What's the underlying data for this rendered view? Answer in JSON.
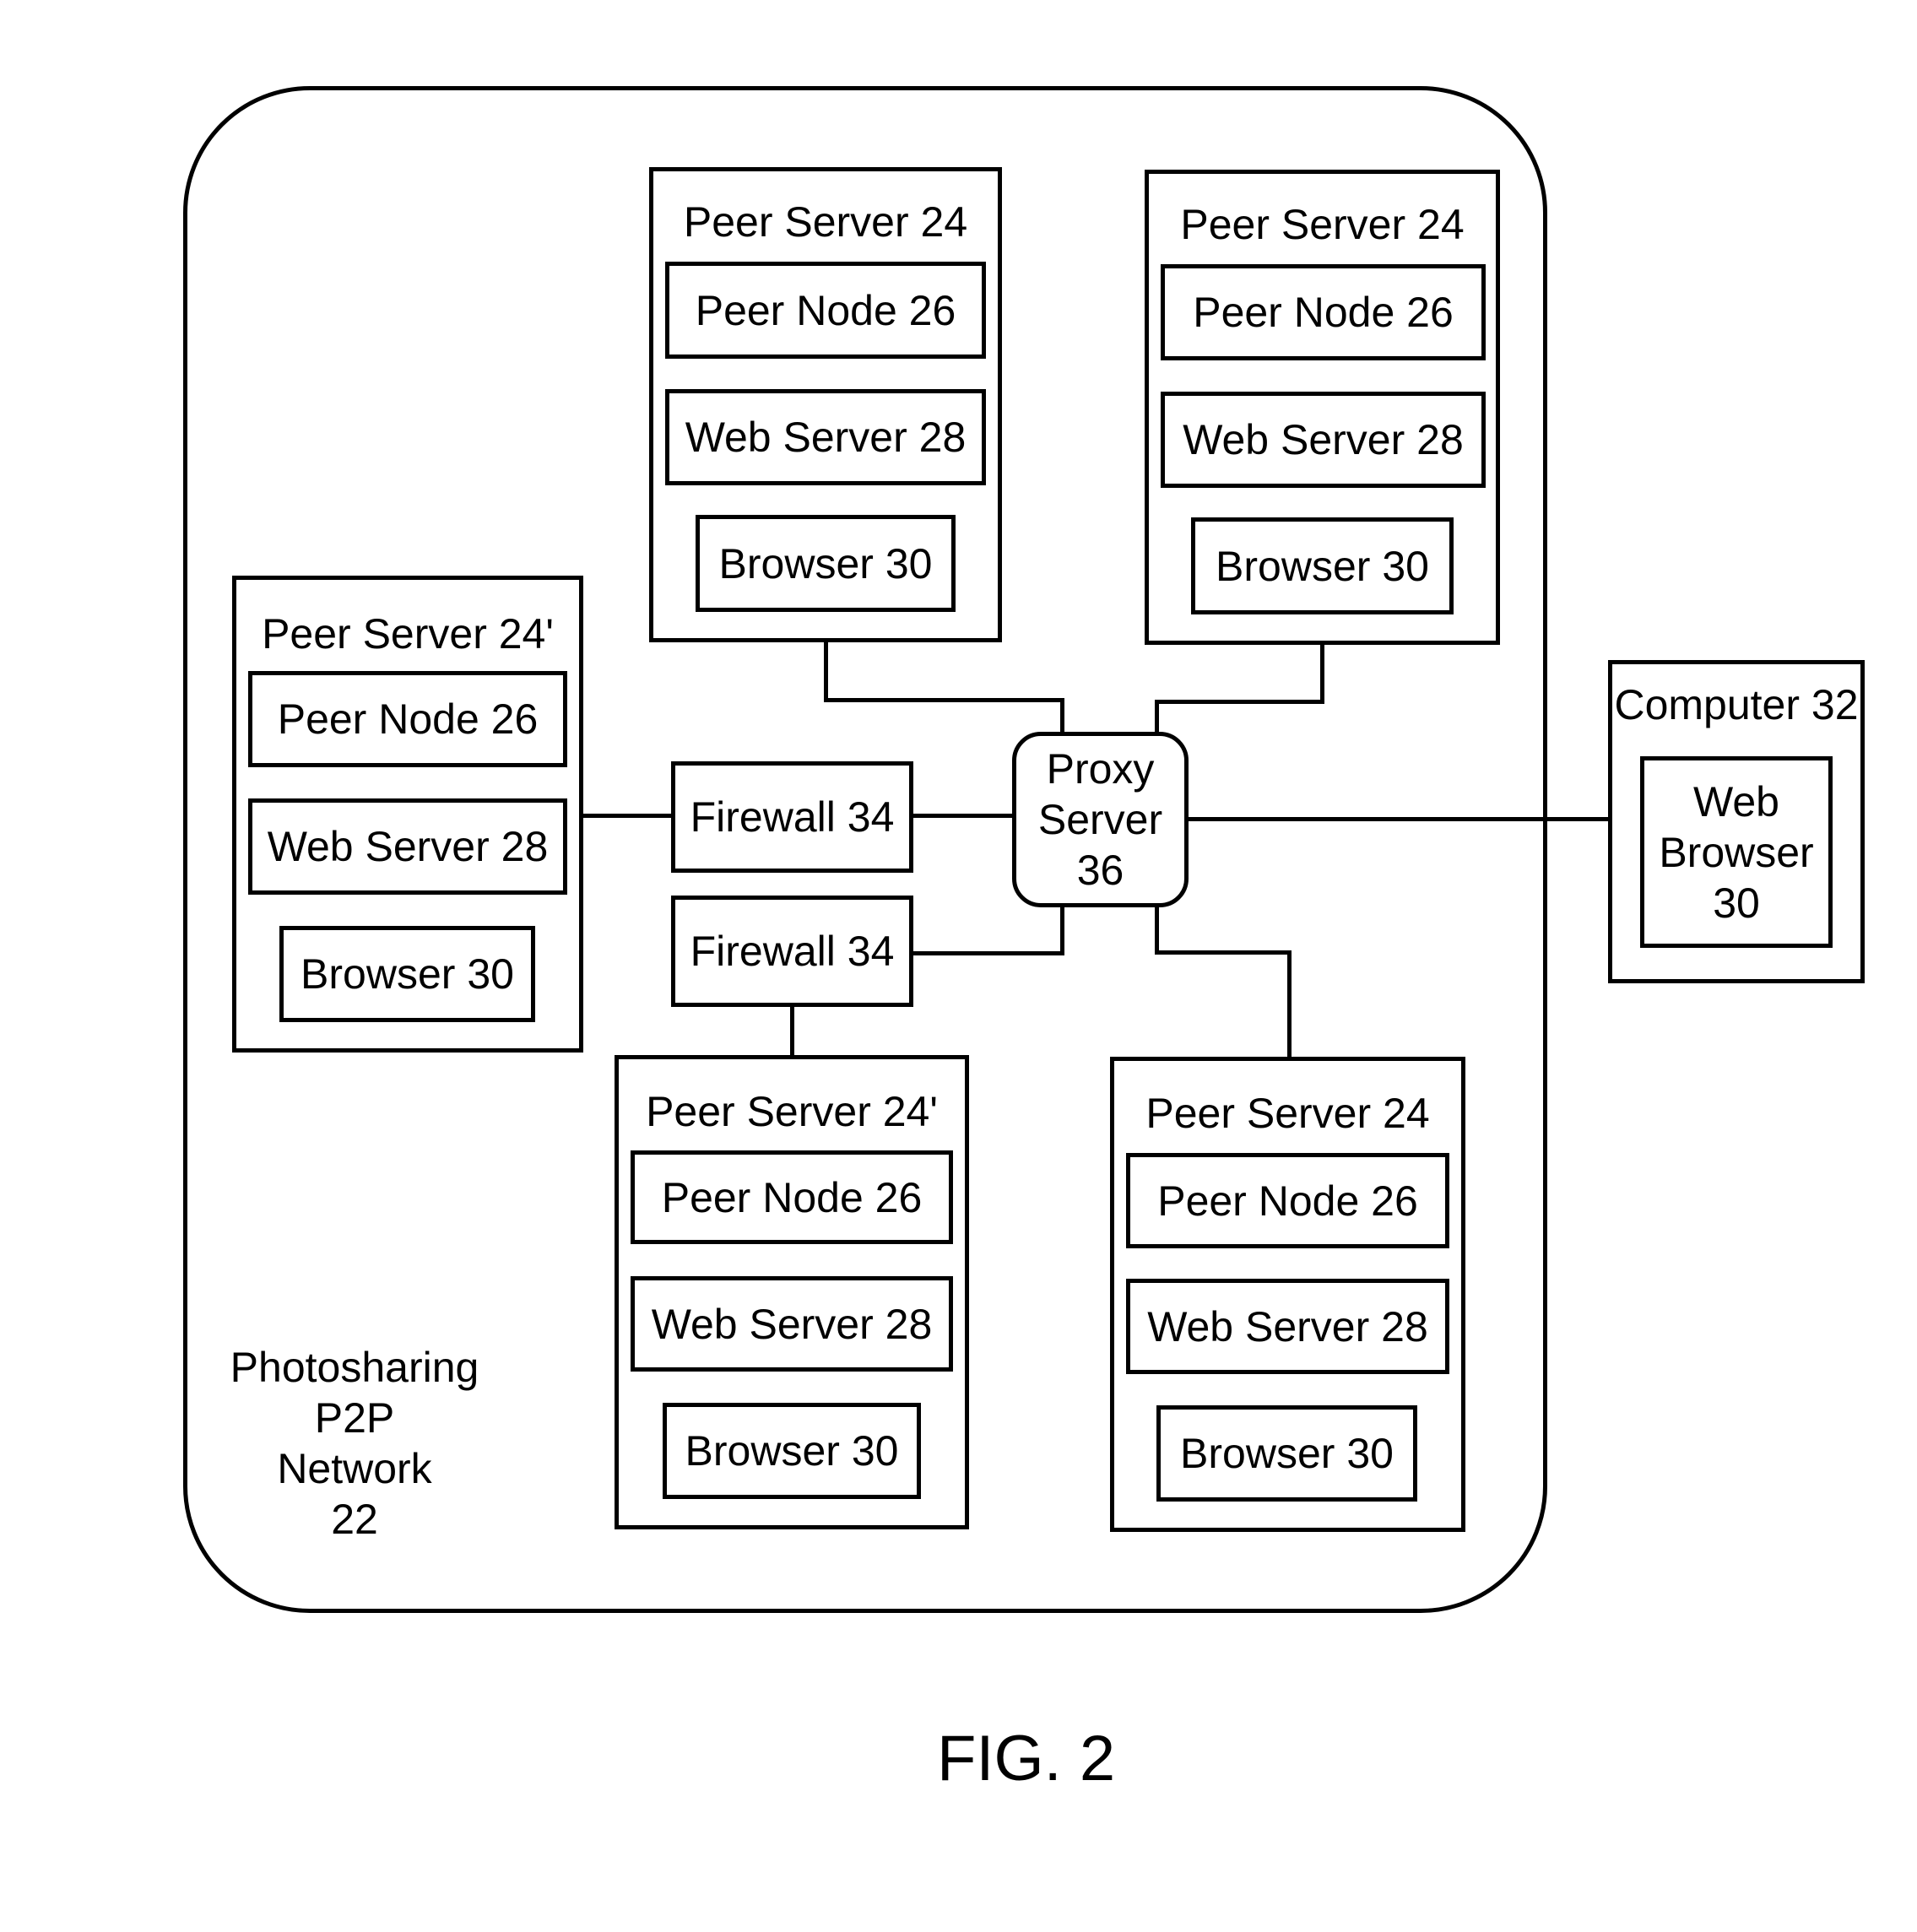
{
  "figure_label": "FIG. 2",
  "network": {
    "line1": "Photosharing",
    "line2": "P2P",
    "line3": "Network",
    "line4": "22"
  },
  "peer_servers": [
    {
      "title": "Peer Server 24",
      "peer_node": "Peer Node 26",
      "web_server": "Web Server 28",
      "browser": "Browser 30"
    },
    {
      "title": "Peer Server 24",
      "peer_node": "Peer Node 26",
      "web_server": "Web Server 28",
      "browser": "Browser 30"
    },
    {
      "title": "Peer Server 24'",
      "peer_node": "Peer Node 26",
      "web_server": "Web Server 28",
      "browser": "Browser 30"
    },
    {
      "title": "Peer Server 24'",
      "peer_node": "Peer Node 26",
      "web_server": "Web Server 28",
      "browser": "Browser 30"
    },
    {
      "title": "Peer Server 24",
      "peer_node": "Peer Node 26",
      "web_server": "Web Server 28",
      "browser": "Browser 30"
    }
  ],
  "firewalls": [
    {
      "label": "Firewall 34"
    },
    {
      "label": "Firewall 34"
    }
  ],
  "proxy": {
    "line1": "Proxy",
    "line2": "Server",
    "line3": "36"
  },
  "computer": {
    "title": "Computer 32",
    "browser_line1": "Web",
    "browser_line2": "Browser",
    "browser_line3": "30"
  }
}
